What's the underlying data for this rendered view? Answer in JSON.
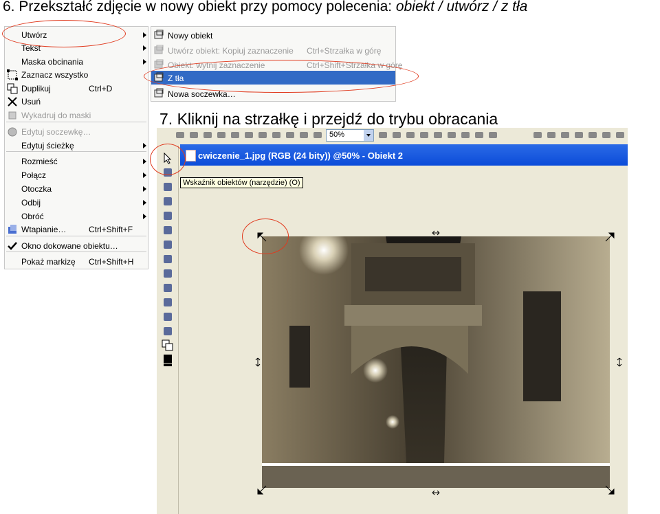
{
  "heading": {
    "prefix": "6. Przekształć zdjęcie w nowy obiekt przy pomocy polecenia: ",
    "command": "obiekt / utwórz / z tła"
  },
  "step7": "7. Kliknij na strzałkę i przejdź do trybu obracania",
  "menu": {
    "items": [
      {
        "label": "Utwórz",
        "shortcut": "",
        "submenu": true,
        "disabled": false,
        "icon": "none"
      },
      {
        "label": "Tekst",
        "shortcut": "",
        "submenu": true,
        "disabled": false,
        "icon": "none"
      },
      {
        "label": "Maska obcinania",
        "shortcut": "",
        "submenu": true,
        "disabled": false,
        "icon": "none"
      },
      {
        "label": "Zaznacz wszystko",
        "shortcut": "",
        "submenu": false,
        "disabled": false,
        "icon": "select-all-icon"
      },
      {
        "label": "Duplikuj",
        "shortcut": "Ctrl+D",
        "submenu": false,
        "disabled": false,
        "icon": "duplicate-icon"
      },
      {
        "label": "Usuń",
        "shortcut": "",
        "submenu": false,
        "disabled": false,
        "icon": "delete-x-icon"
      },
      {
        "label": "Wykadruj do maski",
        "shortcut": "",
        "submenu": false,
        "disabled": true,
        "icon": "crop-icon"
      },
      {
        "label": "Edytuj soczewkę…",
        "shortcut": "",
        "submenu": false,
        "disabled": true,
        "icon": "lens-icon"
      },
      {
        "label": "Edytuj ścieżkę",
        "shortcut": "",
        "submenu": true,
        "disabled": false,
        "icon": "none"
      },
      {
        "label": "Rozmieść",
        "shortcut": "",
        "submenu": true,
        "disabled": false,
        "icon": "none"
      },
      {
        "label": "Połącz",
        "shortcut": "",
        "submenu": true,
        "disabled": false,
        "icon": "none"
      },
      {
        "label": "Otoczka",
        "shortcut": "",
        "submenu": true,
        "disabled": false,
        "icon": "none"
      },
      {
        "label": "Odbij",
        "shortcut": "",
        "submenu": true,
        "disabled": false,
        "icon": "none"
      },
      {
        "label": "Obróć",
        "shortcut": "",
        "submenu": true,
        "disabled": false,
        "icon": "none"
      },
      {
        "label": "Wtapianie…",
        "shortcut": "Ctrl+Shift+F",
        "submenu": false,
        "disabled": false,
        "icon": "feather-icon"
      },
      {
        "label": "Okno dokowane obiektu…",
        "shortcut": "",
        "submenu": false,
        "disabled": false,
        "icon": "checkmark-icon"
      },
      {
        "label": "Pokaż markizę",
        "shortcut": "Ctrl+Shift+H",
        "submenu": false,
        "disabled": false,
        "icon": "none"
      }
    ]
  },
  "submenu": {
    "items": [
      {
        "label": "Nowy obiekt",
        "shortcut": "",
        "disabled": false,
        "selected": false
      },
      {
        "label": "Utwórz obiekt: Kopiuj zaznaczenie",
        "shortcut": "Ctrl+Strzałka w górę",
        "disabled": true,
        "selected": false
      },
      {
        "label": "Obiekt: wytnij zaznaczenie",
        "shortcut": "Ctrl+Shift+Strzałka w górę",
        "disabled": true,
        "selected": false
      },
      {
        "label": "Z tła",
        "shortcut": "",
        "disabled": false,
        "selected": true
      },
      {
        "label": "Nowa soczewka…",
        "shortcut": "",
        "disabled": false,
        "selected": false
      }
    ]
  },
  "app": {
    "zoom": "50%",
    "window_title": "cwiczenie_1.jpg (RGB (24 bity)) @50% - Obiekt 2",
    "tooltip": "Wskaźnik obiektów (narzędzie) (O)"
  },
  "colors": {
    "highlight": "#316ac5",
    "annotation": "#e03a1e",
    "titlebar": "#0b4cd9"
  }
}
